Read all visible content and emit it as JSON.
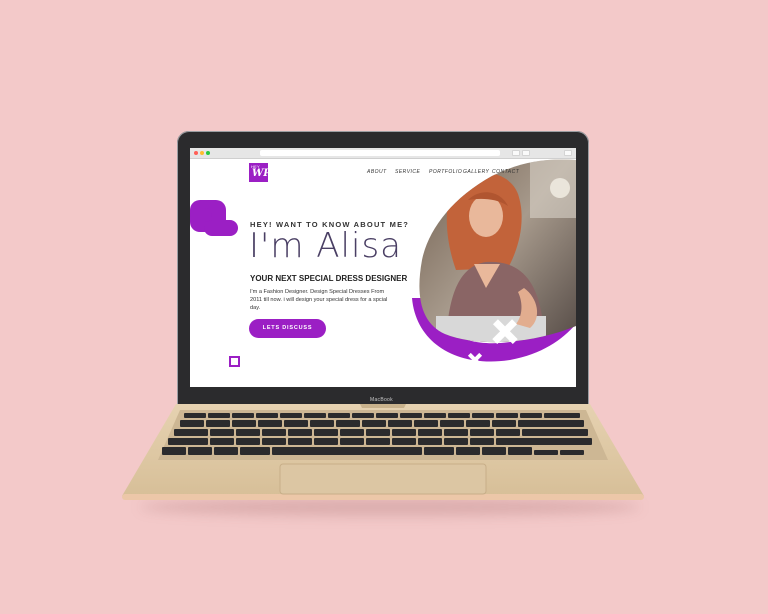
{
  "device": {
    "brand_label": "MacBook"
  },
  "logo": {
    "small": "HEY",
    "main": "WP"
  },
  "nav": {
    "items": [
      "ABOUT",
      "SERVICE",
      "PORTFOLIO",
      "GALLERY",
      "CONTACT"
    ]
  },
  "hero": {
    "kicker": "HEY! WANT TO KNOW ABOUT ME?",
    "name": "I'm Alisa",
    "role": "YOUR NEXT SPECIAL DRESS DESIGNER",
    "description": "I'm a Fashion Designer. Design Special Dresses From 2011 till now. i will design your special dress for a spcial day.",
    "cta": "LETS DISCUSS"
  },
  "colors": {
    "background": "#f3c9c9",
    "accent": "#9b1fc4",
    "heading": "#4a3f64"
  }
}
